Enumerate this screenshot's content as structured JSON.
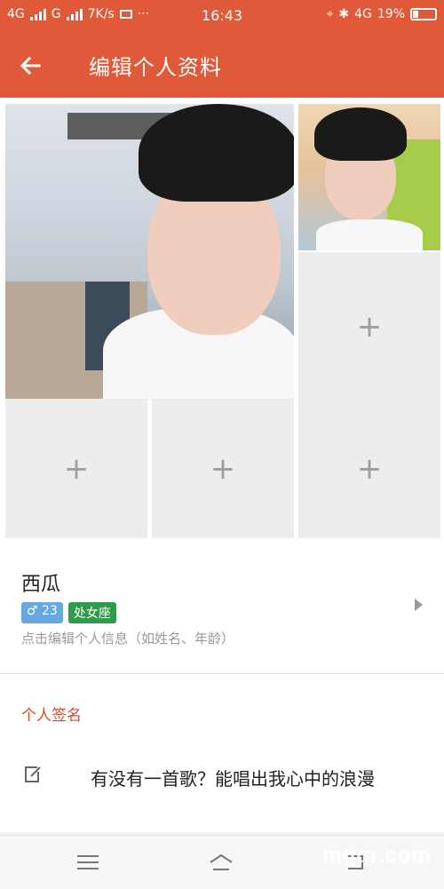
{
  "status_bar": {
    "network_1": "4G",
    "network_2": "G",
    "speed": "7K/s",
    "more": "···",
    "time": "16:43",
    "network_right": "4G",
    "battery": "19%"
  },
  "app_bar": {
    "back_icon": "arrow-left-icon",
    "title": "编辑个人资料"
  },
  "photos": {
    "add_symbol": "+"
  },
  "profile": {
    "name": "西瓜",
    "age_tag": "♂ 23",
    "zodiac_tag": "处女座",
    "hint": "点击编辑个人信息（如姓名、年龄）"
  },
  "signature": {
    "label": "个人签名",
    "text": "有没有一首歌？能唱出我心中的浪漫"
  },
  "colors": {
    "accent": "#e05a3a",
    "age_tag": "#66a9e0",
    "zodiac_tag": "#2e9a4a",
    "section_label": "#d04a2c"
  },
  "watermark": "mgqr.com"
}
